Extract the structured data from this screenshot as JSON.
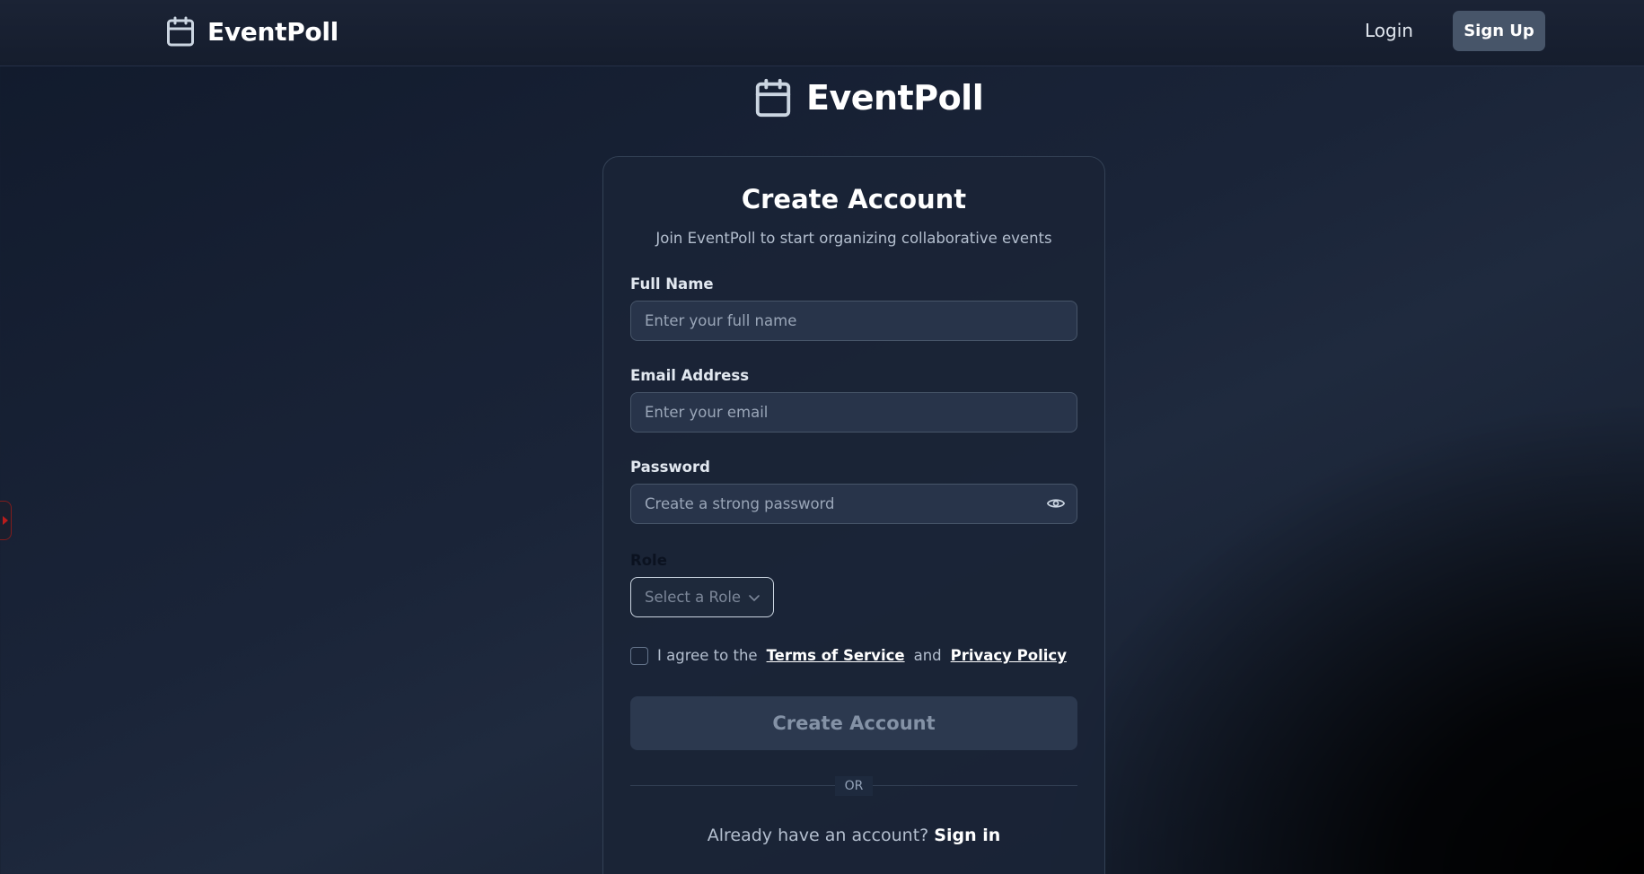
{
  "nav": {
    "brand": "EventPoll",
    "brand_icon": "calendar-icon",
    "login_label": "Login",
    "signup_label": "Sign Up"
  },
  "hero": {
    "brand": "EventPoll",
    "icon": "calendar-icon"
  },
  "form": {
    "title": "Create Account",
    "subtitle": "Join EventPoll to start organizing collaborative events",
    "full_name": {
      "label": "Full Name",
      "placeholder": "Enter your full name",
      "value": ""
    },
    "email": {
      "label": "Email Address",
      "placeholder": "Enter your email",
      "value": ""
    },
    "password": {
      "label": "Password",
      "placeholder": "Create a strong password",
      "value": "",
      "toggle_icon": "eye-icon"
    },
    "role": {
      "label": "Role",
      "selected": "Select a Role"
    },
    "terms": {
      "checked": false,
      "prefix": "I agree to the",
      "terms_link": "Terms of Service",
      "conjunction": "and",
      "privacy_link": "Privacy Policy"
    },
    "submit_label": "Create Account",
    "divider_text": "OR",
    "signin_prompt": "Already have an account?",
    "signin_link": "Sign in"
  },
  "colors": {
    "page_bg": "#1a2438",
    "card_bg": "#1e2a3e",
    "input_bg": "#28344a",
    "signup_button": "#475569",
    "submit_disabled": "#2c394f"
  }
}
